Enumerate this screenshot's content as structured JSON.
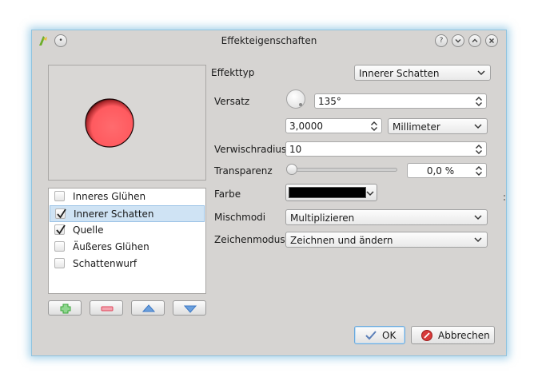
{
  "window": {
    "title": "Effekteigenschaften"
  },
  "effects": [
    {
      "label": "Inneres Glühen",
      "checked": false,
      "selected": false
    },
    {
      "label": "Innerer Schatten",
      "checked": true,
      "selected": true
    },
    {
      "label": "Quelle",
      "checked": true,
      "selected": false
    },
    {
      "label": "Äußeres Glühen",
      "checked": false,
      "selected": false
    },
    {
      "label": "Schattenwurf",
      "checked": false,
      "selected": false
    }
  ],
  "form": {
    "effect_type_label": "Effekttyp",
    "effect_type_value": "Innerer Schatten",
    "offset_label": "Versatz",
    "offset_angle": "135°",
    "offset_distance": "3,0000",
    "offset_unit": "Millimeter",
    "blur_label": "Verwischradius",
    "blur_value": "10",
    "transparency_label": "Transparenz",
    "transparency_value": "0,0 %",
    "transparency_fraction": 0,
    "color_label": "Farbe",
    "color_value": "#000000",
    "blend_label": "Mischmodi",
    "blend_value": "Multiplizieren",
    "draw_label": "Zeichenmodus",
    "draw_value": "Zeichnen und ändern"
  },
  "buttons": {
    "ok": "OK",
    "cancel": "Abbrechen"
  },
  "colors": {
    "accent": "#6aa9dc",
    "selection": "#cfe3f4",
    "preview_fill": "#ff5f63",
    "add_icon": "#3aa63a",
    "remove_icon": "#e0455b",
    "move_icon": "#3d79c6"
  }
}
